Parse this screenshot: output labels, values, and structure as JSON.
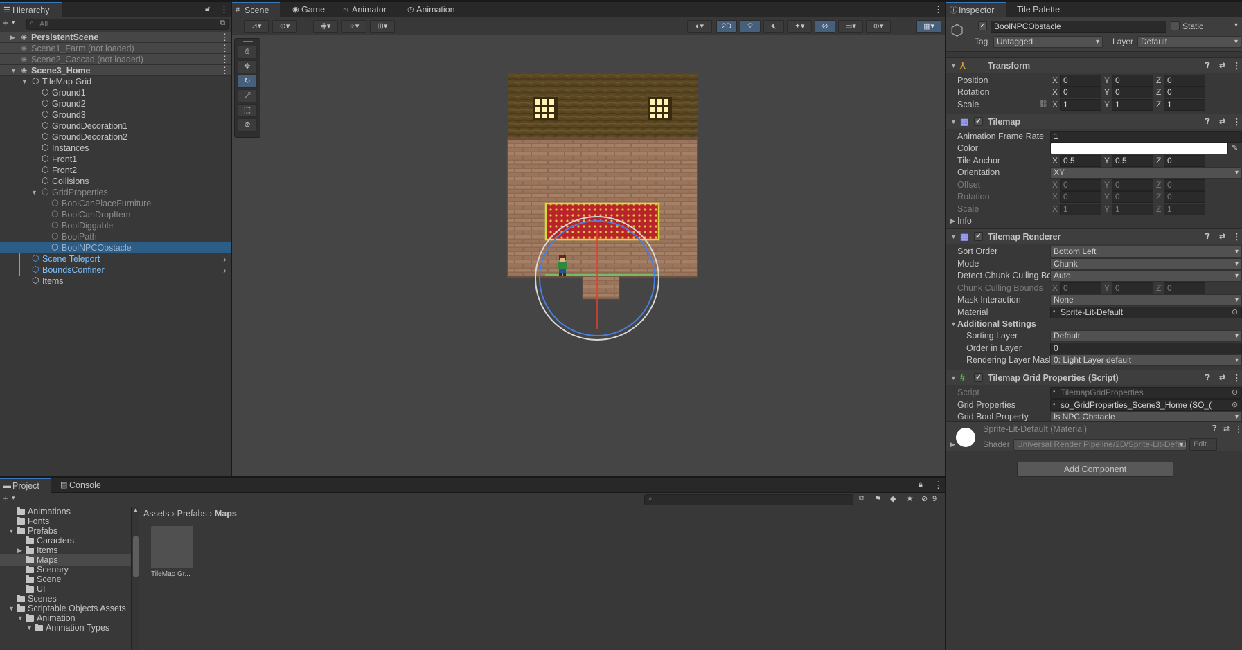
{
  "hierarchy": {
    "tab": "Hierarchy",
    "search_placeholder": "All",
    "rows": [
      {
        "label": "PersistentScene",
        "type": "scene",
        "state": "normal"
      },
      {
        "label": "Scene1_Farm (not loaded)",
        "type": "scene",
        "state": "dim"
      },
      {
        "label": "Scene2_Cascad (not loaded)",
        "type": "scene",
        "state": "dim"
      },
      {
        "label": "Scene3_Home",
        "type": "scene",
        "state": "normal"
      },
      {
        "label": "TileMap Grid",
        "type": "object",
        "state": "normal"
      },
      {
        "label": "Ground1",
        "type": "object",
        "state": "normal"
      },
      {
        "label": "Ground2",
        "type": "object",
        "state": "normal"
      },
      {
        "label": "Ground3",
        "type": "object",
        "state": "normal"
      },
      {
        "label": "GroundDecoration1",
        "type": "object",
        "state": "normal"
      },
      {
        "label": "GroundDecoration2",
        "type": "object",
        "state": "normal"
      },
      {
        "label": "Instances",
        "type": "object",
        "state": "normal"
      },
      {
        "label": "Front1",
        "type": "object",
        "state": "normal"
      },
      {
        "label": "Front2",
        "type": "object",
        "state": "normal"
      },
      {
        "label": "Collisions",
        "type": "object",
        "state": "normal"
      },
      {
        "label": "GridProperties",
        "type": "object",
        "state": "dim"
      },
      {
        "label": "BoolCanPlaceFurniture",
        "type": "object",
        "state": "dim"
      },
      {
        "label": "BoolCanDropItem",
        "type": "object",
        "state": "dim"
      },
      {
        "label": "BoolDiggable",
        "type": "object",
        "state": "dim"
      },
      {
        "label": "BoolPath",
        "type": "object",
        "state": "dim"
      },
      {
        "label": "BoolNPCObstacle",
        "type": "object",
        "state": "selected"
      },
      {
        "label": "Scene Teleport",
        "type": "prefab",
        "state": "blue"
      },
      {
        "label": "BoundsConfiner",
        "type": "prefab",
        "state": "blue"
      },
      {
        "label": "Items",
        "type": "object",
        "state": "normal"
      }
    ]
  },
  "scene_view": {
    "tabs": [
      "Scene",
      "Game",
      "Animator",
      "Animation"
    ],
    "toolbar_2d_label": "2D"
  },
  "inspector": {
    "tabs": [
      "Inspector",
      "Tile Palette"
    ],
    "object_name": "BoolNPCObstacle",
    "static_label": "Static",
    "tag_label": "Tag",
    "tag_value": "Untagged",
    "layer_label": "Layer",
    "layer_value": "Default",
    "transform": {
      "title": "Transform",
      "position_label": "Position",
      "rotation_label": "Rotation",
      "scale_label": "Scale",
      "position": [
        "0",
        "0",
        "0"
      ],
      "rotation": [
        "0",
        "0",
        "0"
      ],
      "scale": [
        "1",
        "1",
        "1"
      ]
    },
    "tilemap": {
      "title": "Tilemap",
      "rows": [
        {
          "label": "Animation Frame Rate",
          "value": "1"
        },
        {
          "label": "Color",
          "value": ""
        },
        {
          "label": "Tile Anchor",
          "value": [
            "0.5",
            "0.5",
            "0"
          ]
        },
        {
          "label": "Orientation",
          "value": "XY"
        },
        {
          "label": "Offset",
          "value": [
            "0",
            "0",
            "0"
          ]
        },
        {
          "label": "Rotation",
          "value": [
            "0",
            "0",
            "0"
          ]
        },
        {
          "label": "Scale",
          "value": [
            "1",
            "1",
            "1"
          ]
        }
      ],
      "info_label": "Info"
    },
    "renderer": {
      "title": "Tilemap Renderer",
      "rows": [
        {
          "label": "Sort Order",
          "value": "Bottom Left"
        },
        {
          "label": "Mode",
          "value": "Chunk"
        },
        {
          "label": "Detect Chunk Culling Bounds",
          "value": "Auto"
        },
        {
          "label": "Chunk Culling Bounds",
          "value": [
            "0",
            "0",
            "0"
          ]
        },
        {
          "label": "Mask Interaction",
          "value": "None"
        },
        {
          "label": "Material",
          "value": "Sprite-Lit-Default"
        }
      ],
      "additional_title": "Additional Settings",
      "additional_rows": [
        {
          "label": "Sorting Layer",
          "value": "Default"
        },
        {
          "label": "Order in Layer",
          "value": "0"
        },
        {
          "label": "Rendering Layer Mask",
          "value": "0: Light Layer default"
        }
      ]
    },
    "grid_props": {
      "title": "Tilemap Grid Properties (Script)",
      "rows": [
        {
          "label": "Script",
          "value": "TilemapGridProperties"
        },
        {
          "label": "Grid Properties",
          "value": "so_GridProperties_Scene3_Home (SO_("
        },
        {
          "label": "Grid Bool Property",
          "value": "Is NPC Obstacle"
        }
      ]
    },
    "material": {
      "title": "Sprite-Lit-Default (Material)",
      "shader_label": "Shader",
      "shader_value": "Universal Render Pipeline/2D/Sprite-Lit-Defau",
      "edit_label": "Edit..."
    },
    "add_component": "Add Component"
  },
  "project": {
    "tabs": [
      "Project",
      "Console"
    ],
    "breadcrumb": [
      "Assets",
      "Prefabs",
      "Maps"
    ],
    "visible_count": "9",
    "tree": [
      {
        "label": "Animations",
        "indent": 1,
        "arrow": ""
      },
      {
        "label": "Fonts",
        "indent": 1,
        "arrow": ""
      },
      {
        "label": "Prefabs",
        "indent": 1,
        "arrow": "down"
      },
      {
        "label": "Caracters",
        "indent": 2,
        "arrow": ""
      },
      {
        "label": "Items",
        "indent": 2,
        "arrow": "right"
      },
      {
        "label": "Maps",
        "indent": 2,
        "arrow": "",
        "selected": true
      },
      {
        "label": "Scenary",
        "indent": 2,
        "arrow": ""
      },
      {
        "label": "Scene",
        "indent": 2,
        "arrow": ""
      },
      {
        "label": "UI",
        "indent": 2,
        "arrow": ""
      },
      {
        "label": "Scenes",
        "indent": 1,
        "arrow": ""
      },
      {
        "label": "Scriptable Objects Assets",
        "indent": 1,
        "arrow": "down"
      },
      {
        "label": "Animation",
        "indent": 2,
        "arrow": "down"
      },
      {
        "label": "Animation Types",
        "indent": 3,
        "arrow": "down"
      }
    ],
    "asset_label": "TileMap Gr..."
  }
}
